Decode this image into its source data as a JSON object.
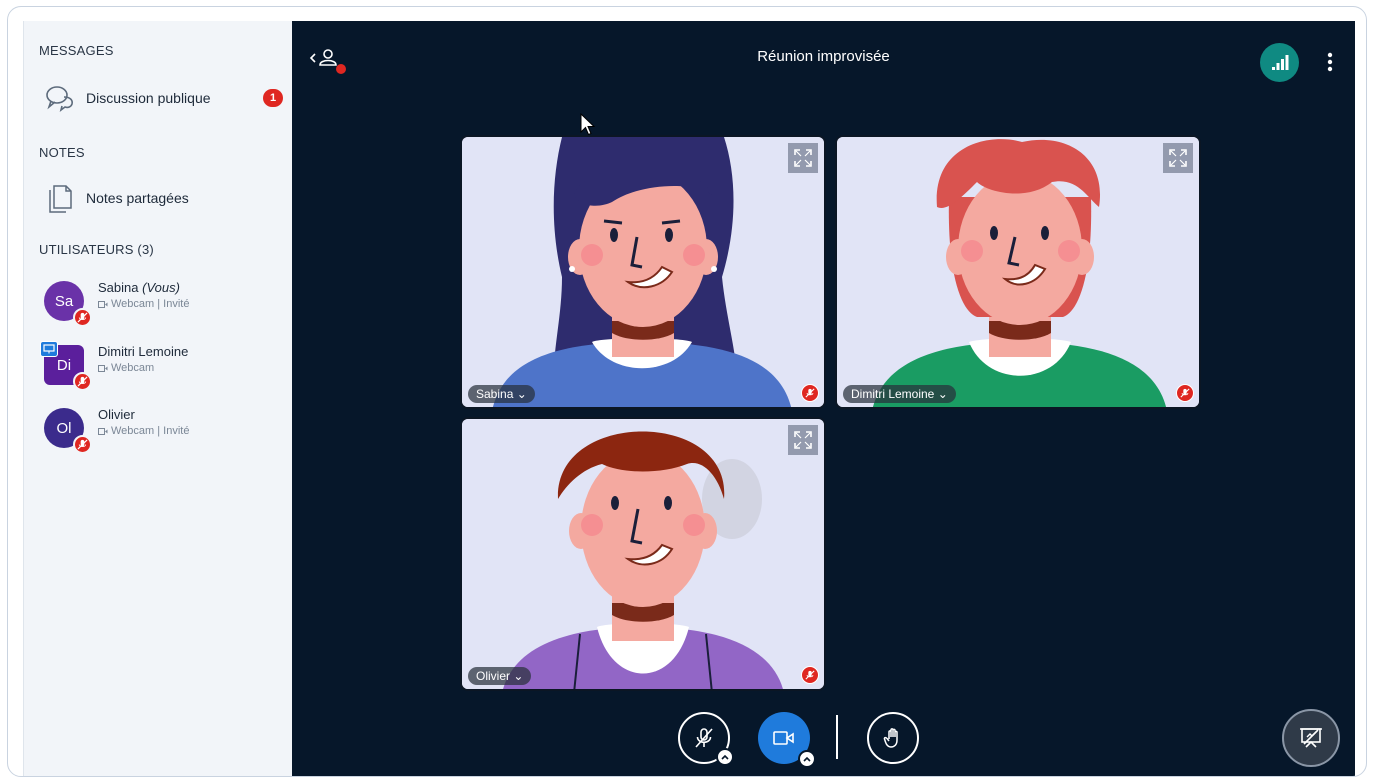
{
  "sidebar": {
    "messages_title": "MESSAGES",
    "public_chat_label": "Discussion publique",
    "public_chat_badge": "1",
    "notes_title": "NOTES",
    "shared_notes_label": "Notes partagées",
    "users_title": "UTILISATEURS (3)",
    "users": [
      {
        "initials": "Sa",
        "name": "Sabina",
        "you_suffix": "(Vous)",
        "meta": "Webcam | Invité",
        "color": "#6a32a8"
      },
      {
        "initials": "Di",
        "name": "Dimitri Lemoine",
        "meta": "Webcam",
        "color": "#5b1f9c"
      },
      {
        "initials": "Ol",
        "name": "Olivier",
        "meta": "Webcam | Invité",
        "color": "#3b2b8c"
      }
    ]
  },
  "header": {
    "meeting_title": "Réunion improvisée",
    "connection_color": "#0f8a82"
  },
  "videos": [
    {
      "name": "Sabina",
      "hair": "#2e2c6e",
      "shirt": "#4e74c9"
    },
    {
      "name": "Dimitri Lemoine",
      "hair": "#d9534f",
      "shirt": "#1a9c63"
    },
    {
      "name": "Olivier",
      "hair": "#8c2610",
      "shirt": "#9266c6"
    }
  ],
  "colors": {
    "accent": "#1f7bdc",
    "danger": "#df2721",
    "background": "#06172a"
  }
}
